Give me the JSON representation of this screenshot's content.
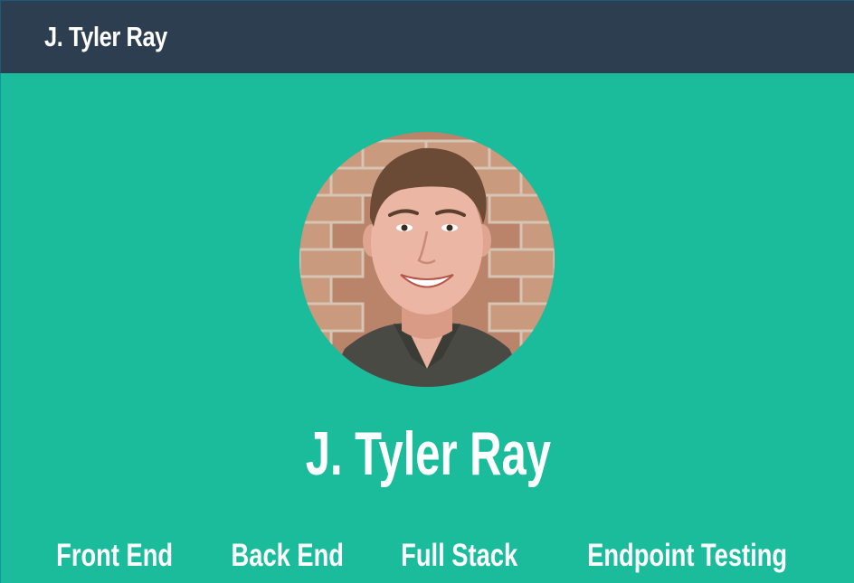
{
  "navbar": {
    "brand": "J. Tyler Ray"
  },
  "hero": {
    "name": "J. Tyler Ray",
    "avatar_alt": "avatar"
  },
  "skills": [
    {
      "label": "Front End"
    },
    {
      "label": "Back End"
    },
    {
      "label": "Full Stack"
    },
    {
      "label": "Endpoint Testing"
    }
  ],
  "colors": {
    "navbar_bg": "#2c3e50",
    "hero_bg": "#1abc9c",
    "text": "#ffffff"
  }
}
